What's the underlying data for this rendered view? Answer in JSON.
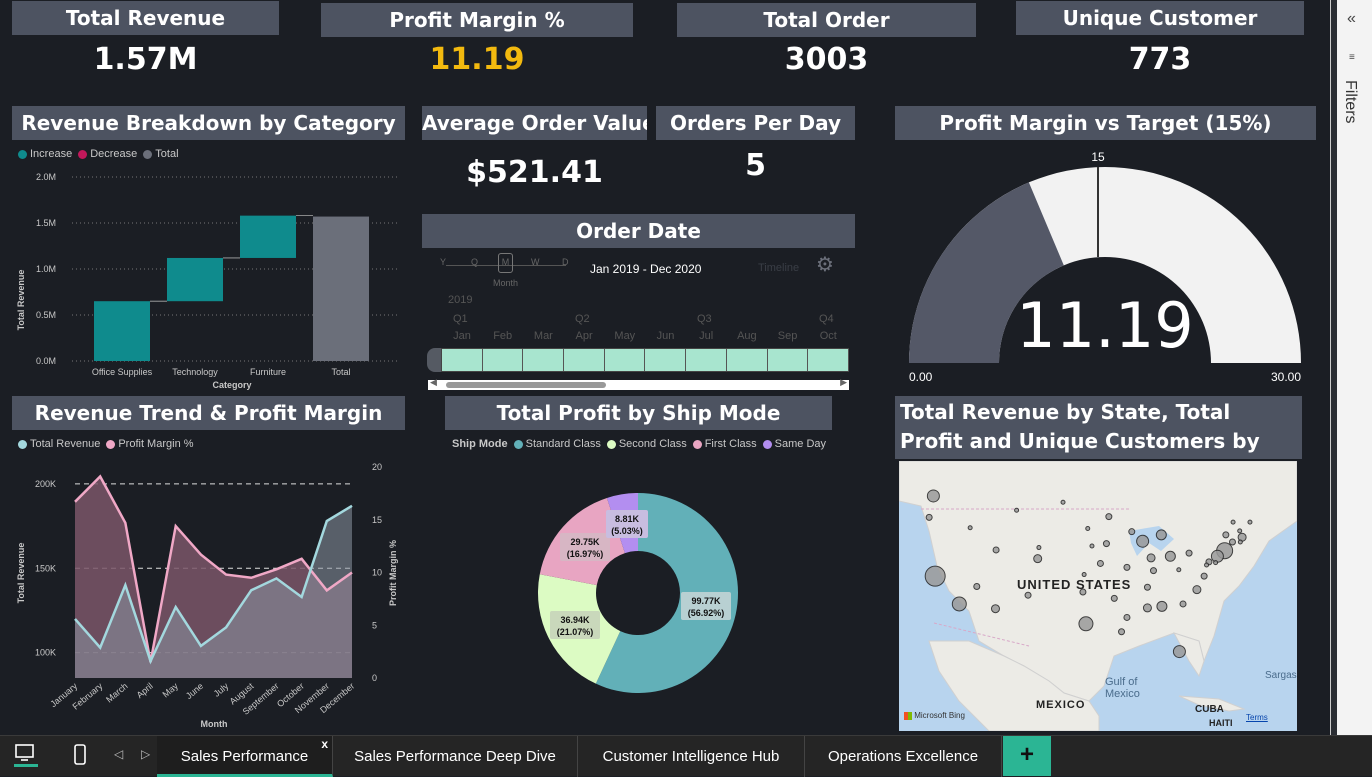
{
  "kpis": {
    "total_revenue": {
      "title": "Total Revenue",
      "value": "1.57M"
    },
    "profit_margin": {
      "title": "Profit Margin %",
      "value": "11.19"
    },
    "total_order": {
      "title": "Total Order",
      "value": "3003"
    },
    "unique_customer": {
      "title": "Unique Customer",
      "value": "773"
    },
    "avg_order_value": {
      "title": "Average Order Value",
      "value": "$521.41"
    },
    "orders_per_day": {
      "title": "Orders Per Day",
      "value": "5"
    }
  },
  "colors": {
    "accent_gold": "#f2b90f",
    "header_bg": "#4d5361",
    "increase": "#0f8b8d",
    "decrease": "#c2185b",
    "total": "#6b6f7a"
  },
  "waterfall": {
    "title": "Revenue Breakdown by Category",
    "legend": [
      "Increase",
      "Decrease",
      "Total"
    ],
    "y_ticks": [
      "2.0M",
      "1.5M",
      "1.0M",
      "0.5M",
      "0.0M"
    ],
    "y_label": "Total Revenue",
    "x_label": "Category"
  },
  "order_date": {
    "title": "Order Date",
    "granularity": [
      "Y",
      "Q",
      "M",
      "W",
      "D"
    ],
    "granularity_selected": "Month",
    "range": "Jan 2019 - Dec 2020",
    "year": "2019",
    "quarters": [
      "Q1",
      "Q2",
      "Q3",
      "Q4"
    ],
    "months": [
      "Jan",
      "Feb",
      "Mar",
      "Apr",
      "May",
      "Jun",
      "Jul",
      "Aug",
      "Sep",
      "Oct"
    ],
    "watermark": "Timeline"
  },
  "gauge": {
    "title": "Profit Margin vs Target (15%)",
    "value": "11.19",
    "min": "0.00",
    "max": "30.00",
    "target": "15"
  },
  "trend": {
    "title": "Revenue Trend & Profit Margin",
    "legend": [
      "Total Revenue",
      "Profit Margin %"
    ],
    "y_left_ticks": [
      "200K",
      "150K",
      "100K"
    ],
    "y_right_ticks": [
      "20",
      "15",
      "10",
      "5",
      "0"
    ],
    "y_left_label": "Total Revenue",
    "y_right_label": "Profit Margin %",
    "x_label": "Month"
  },
  "donut": {
    "title": "Total Profit by Ship Mode",
    "legend_title": "Ship Mode",
    "legend": [
      "Standard Class",
      "Second Class",
      "First Class",
      "Same Day"
    ],
    "labels": [
      {
        "line1": "99.77K",
        "line2": "(56.92%)"
      },
      {
        "line1": "36.94K",
        "line2": "(21.07%)"
      },
      {
        "line1": "29.75K",
        "line2": "(16.97%)"
      },
      {
        "line1": "8.81K",
        "line2": "(5.03%)"
      }
    ]
  },
  "map": {
    "title": "Total Revenue by State, Total Profit and Unique Customers by State",
    "country": "UNITED STATES",
    "gulf": "Gulf of Mexico",
    "mexico": "MEXICO",
    "cuba": "CUBA",
    "haiti": "HAITI",
    "sargasso": "Sargas",
    "attribution": "Microsoft Bing",
    "terms": "Terms"
  },
  "filters": {
    "label": "Filters"
  },
  "tabs": [
    "Sales Performance",
    "Sales Performance Deep Dive",
    "Customer Intelligence Hub",
    "Operations Excellence"
  ],
  "chart_data": [
    {
      "type": "bar",
      "title": "Revenue Breakdown by Category",
      "subtype": "waterfall",
      "categories": [
        "Office Supplies",
        "Technology",
        "Furniture",
        "Total"
      ],
      "values": [
        0.65,
        0.47,
        0.46,
        1.57
      ],
      "ylim": [
        0,
        2.0
      ],
      "ylabel": "Total Revenue",
      "xlabel": "Category"
    },
    {
      "type": "area",
      "title": "Revenue Trend & Profit Margin",
      "categories": [
        "January",
        "February",
        "March",
        "April",
        "May",
        "June",
        "July",
        "August",
        "September",
        "October",
        "November",
        "December"
      ],
      "series": [
        {
          "name": "Total Revenue",
          "axis": "left",
          "values": [
            120000,
            103000,
            140000,
            95000,
            127000,
            104000,
            115000,
            137000,
            144000,
            133000,
            178000,
            187000
          ]
        },
        {
          "name": "Profit Margin %",
          "axis": "right",
          "values": [
            16.7,
            19.1,
            14.7,
            1.5,
            14.4,
            11.7,
            9.8,
            9.5,
            10.3,
            11.3,
            8.3,
            10.0
          ]
        }
      ],
      "ylim_left": [
        85000,
        210000
      ],
      "ylim_right": [
        0,
        20
      ],
      "xlabel": "Month"
    },
    {
      "type": "pie",
      "title": "Total Profit by Ship Mode",
      "categories": [
        "Standard Class",
        "Second Class",
        "First Class",
        "Same Day"
      ],
      "values": [
        99.77,
        36.94,
        29.75,
        8.81
      ],
      "percent": [
        56.92,
        21.07,
        16.97,
        5.03
      ],
      "colors": [
        "#62b0b8",
        "#dcfbc3",
        "#e8a5c2",
        "#b38ef0"
      ]
    }
  ],
  "states_bubbles": [
    {
      "lon": -122,
      "lat": 37.5,
      "r": 10
    },
    {
      "lon": -118,
      "lat": 34,
      "r": 7
    },
    {
      "lon": -122.3,
      "lat": 47.6,
      "r": 6
    },
    {
      "lon": -74,
      "lat": 40.7,
      "r": 8
    },
    {
      "lon": -87.6,
      "lat": 41.9,
      "r": 6
    },
    {
      "lon": -97,
      "lat": 31.5,
      "r": 7
    },
    {
      "lon": -75.2,
      "lat": 40,
      "r": 6
    },
    {
      "lon": -83,
      "lat": 40,
      "r": 5
    },
    {
      "lon": -84.4,
      "lat": 33.7,
      "r": 5
    },
    {
      "lon": -81.5,
      "lat": 28,
      "r": 6
    },
    {
      "lon": -105,
      "lat": 39.7,
      "r": 4
    },
    {
      "lon": -112,
      "lat": 33.4,
      "r": 4
    },
    {
      "lon": -84.5,
      "lat": 42.7,
      "r": 5
    },
    {
      "lon": -78.6,
      "lat": 35.8,
      "r": 4
    },
    {
      "lon": -86.2,
      "lat": 39.8,
      "r": 4
    },
    {
      "lon": -93.2,
      "lat": 45,
      "r": 3
    },
    {
      "lon": -90.2,
      "lat": 38.6,
      "r": 3
    },
    {
      "lon": -77.4,
      "lat": 37.5,
      "r": 3
    },
    {
      "lon": -71.1,
      "lat": 42.4,
      "r": 4
    },
    {
      "lon": -86.8,
      "lat": 36.1,
      "r": 3
    },
    {
      "lon": -89.4,
      "lat": 43.1,
      "r": 3
    },
    {
      "lon": -115.1,
      "lat": 36.2,
      "r": 3
    },
    {
      "lon": -111.9,
      "lat": 40.8,
      "r": 3
    },
    {
      "lon": -116.2,
      "lat": 43.6,
      "r": 2
    },
    {
      "lon": -106.6,
      "lat": 35.1,
      "r": 3
    },
    {
      "lon": -97.5,
      "lat": 35.5,
      "r": 3
    },
    {
      "lon": -92.3,
      "lat": 34.7,
      "r": 3
    },
    {
      "lon": -90.2,
      "lat": 32.3,
      "r": 3
    },
    {
      "lon": -91.1,
      "lat": 30.5,
      "r": 3
    },
    {
      "lon": -86.8,
      "lat": 33.5,
      "r": 4
    },
    {
      "lon": -80.9,
      "lat": 34,
      "r": 3
    },
    {
      "lon": -85.8,
      "lat": 38.2,
      "r": 3
    },
    {
      "lon": -94.6,
      "lat": 39.1,
      "r": 3
    },
    {
      "lon": -96,
      "lat": 41.3,
      "r": 2
    },
    {
      "lon": -93.6,
      "lat": 41.6,
      "r": 3
    },
    {
      "lon": -96.7,
      "lat": 43.5,
      "r": 2
    },
    {
      "lon": -100.8,
      "lat": 46.8,
      "r": 2
    },
    {
      "lon": -104.8,
      "lat": 41.1,
      "r": 2
    },
    {
      "lon": -108.5,
      "lat": 45.8,
      "r": 2
    },
    {
      "lon": -123,
      "lat": 44.9,
      "r": 3
    },
    {
      "lon": -76.6,
      "lat": 39.3,
      "r": 3
    },
    {
      "lon": -72.7,
      "lat": 41.8,
      "r": 3
    },
    {
      "lon": -71.4,
      "lat": 41.8,
      "r": 2
    },
    {
      "lon": -75.5,
      "lat": 39.2,
      "r": 2
    },
    {
      "lon": -79.9,
      "lat": 40.4,
      "r": 3
    },
    {
      "lon": -81.6,
      "lat": 38.3,
      "r": 2
    },
    {
      "lon": -73.8,
      "lat": 42.7,
      "r": 3
    },
    {
      "lon": -72.6,
      "lat": 44.3,
      "r": 2
    },
    {
      "lon": -71.5,
      "lat": 43.2,
      "r": 2
    },
    {
      "lon": -69.8,
      "lat": 44.3,
      "r": 2
    },
    {
      "lon": -77,
      "lat": 38.9,
      "r": 2
    },
    {
      "lon": -97.3,
      "lat": 37.7,
      "r": 2
    }
  ]
}
